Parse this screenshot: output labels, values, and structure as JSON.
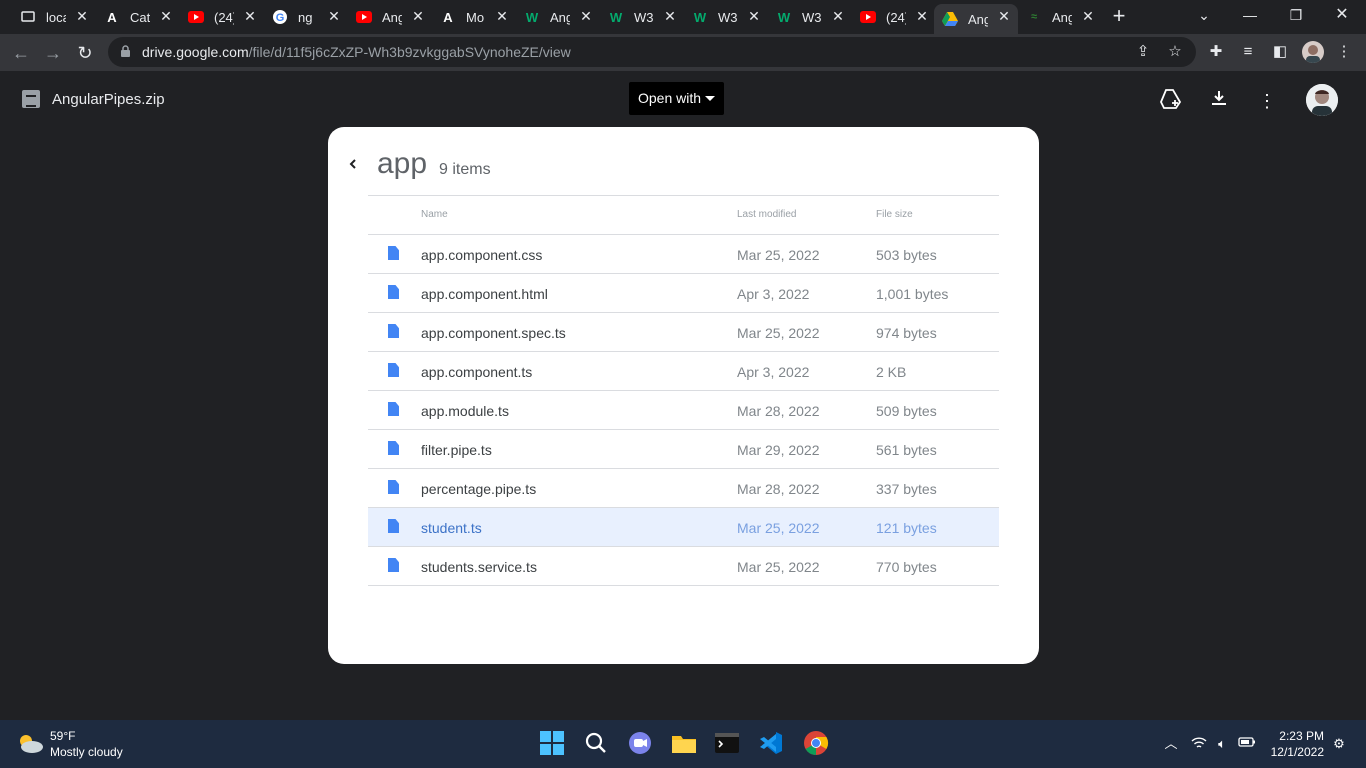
{
  "browser": {
    "tabs": [
      {
        "icon": "monitor-favicon",
        "title": "loca"
      },
      {
        "icon": "angular-favicon",
        "title": "Cat"
      },
      {
        "icon": "youtube-favicon",
        "title": "(24)"
      },
      {
        "icon": "google-favicon",
        "title": "ng"
      },
      {
        "icon": "youtube-favicon",
        "title": "Ang"
      },
      {
        "icon": "angular-favicon",
        "title": "Mo"
      },
      {
        "icon": "w3schools-favicon",
        "title": "Ang"
      },
      {
        "icon": "w3schools-favicon",
        "title": "W3"
      },
      {
        "icon": "w3schools-favicon",
        "title": "W3"
      },
      {
        "icon": "w3schools-favicon",
        "title": "W3"
      },
      {
        "icon": "youtube-favicon",
        "title": "(24)"
      },
      {
        "icon": "google-drive-favicon",
        "title": "Ang"
      },
      {
        "icon": "angular-favicon",
        "title": "Ang"
      }
    ],
    "active_tab": 11,
    "url_host": "drive.google.com",
    "url_path": "/file/d/11f5j6cZxZP-Wh3b9zvkggabSVynoheZE/view"
  },
  "drive": {
    "file_name": "AngularPipes.zip",
    "open_with_label": "Open with"
  },
  "folder": {
    "name": "app",
    "count": "9 items",
    "columns": {
      "name": "Name",
      "modified": "Last modified",
      "size": "File size"
    },
    "rows": [
      {
        "name": "app.component.css",
        "modified": "Mar 25, 2022",
        "size": "503 bytes"
      },
      {
        "name": "app.component.html",
        "modified": "Apr 3, 2022",
        "size": "1,001 bytes"
      },
      {
        "name": "app.component.spec.ts",
        "modified": "Mar 25, 2022",
        "size": "974 bytes"
      },
      {
        "name": "app.component.ts",
        "modified": "Apr 3, 2022",
        "size": "2 KB"
      },
      {
        "name": "app.module.ts",
        "modified": "Mar 28, 2022",
        "size": "509 bytes"
      },
      {
        "name": "filter.pipe.ts",
        "modified": "Mar 29, 2022",
        "size": "561 bytes"
      },
      {
        "name": "percentage.pipe.ts",
        "modified": "Mar 28, 2022",
        "size": "337 bytes"
      },
      {
        "name": "student.ts",
        "modified": "Mar 25, 2022",
        "size": "121 bytes"
      },
      {
        "name": "students.service.ts",
        "modified": "Mar 25, 2022",
        "size": "770 bytes"
      }
    ],
    "selected_row": 7
  },
  "taskbar": {
    "temperature": "59°F",
    "weather": "Mostly cloudy",
    "time": "2:23 PM",
    "date": "12/1/2022"
  },
  "colors": {
    "page_bg": "#202124",
    "panel_bg": "#ffffff",
    "selected_row": "#e8f0fe",
    "doc_icon": "#4285f4",
    "taskbar_bg": "#1e2b40"
  }
}
